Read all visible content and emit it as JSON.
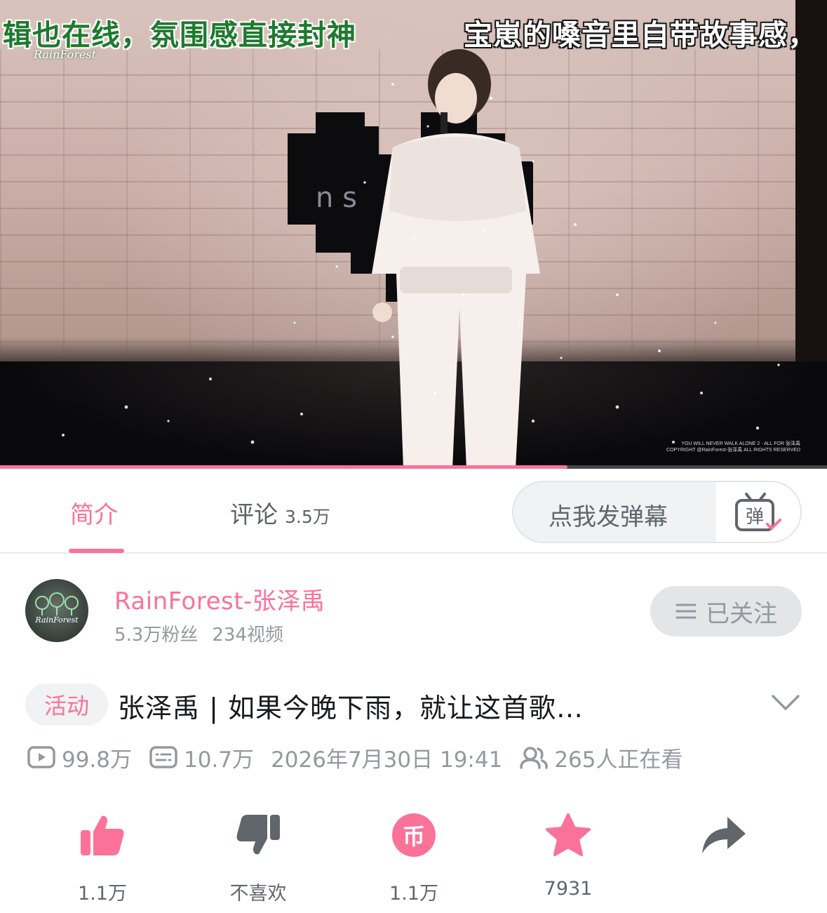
{
  "video": {
    "subtitle_left": "辑也在线，氛围感直接封神",
    "subtitle_right": "宝崽的嗓音里自带故事感，",
    "watermark": "RainForest",
    "copyright_line1": "YOU WILL NEVER WALK ALONE 2 · ALL FOR 张泽禹",
    "copyright_line2": "COPYRIGHT @RainForest-张泽禹 ALL RIGHTS RESERVED",
    "progress": 0.686,
    "accent_color": "#fb7299"
  },
  "tabs": {
    "intro_label": "简介",
    "comments_label": "评论",
    "comments_count": "3.5万",
    "danmaku_placeholder": "点我发弹幕",
    "danmaku_icon_char": "弹"
  },
  "uploader": {
    "name": "RainForest-张泽禹",
    "fans": "5.3万粉丝",
    "videos": "234视频",
    "follow_label": "已关注",
    "avatar_text": "RainForest"
  },
  "video_info": {
    "badge": "活动",
    "title": "张泽禹 | 如果今晚下雨，就让这首歌…",
    "plays": "99.8万",
    "danmaku_count": "10.7万",
    "date": "2026年7月30日 19:41",
    "watching": "265人正在看"
  },
  "actions": {
    "like": "1.1万",
    "dislike": "不喜欢",
    "coin": "1.1万",
    "coin_char": "币",
    "favorite": "7931",
    "share": ""
  },
  "colors": {
    "brand_pink": "#fb7299",
    "text_gray": "#9499a0",
    "icon_dark": "#61666d"
  }
}
